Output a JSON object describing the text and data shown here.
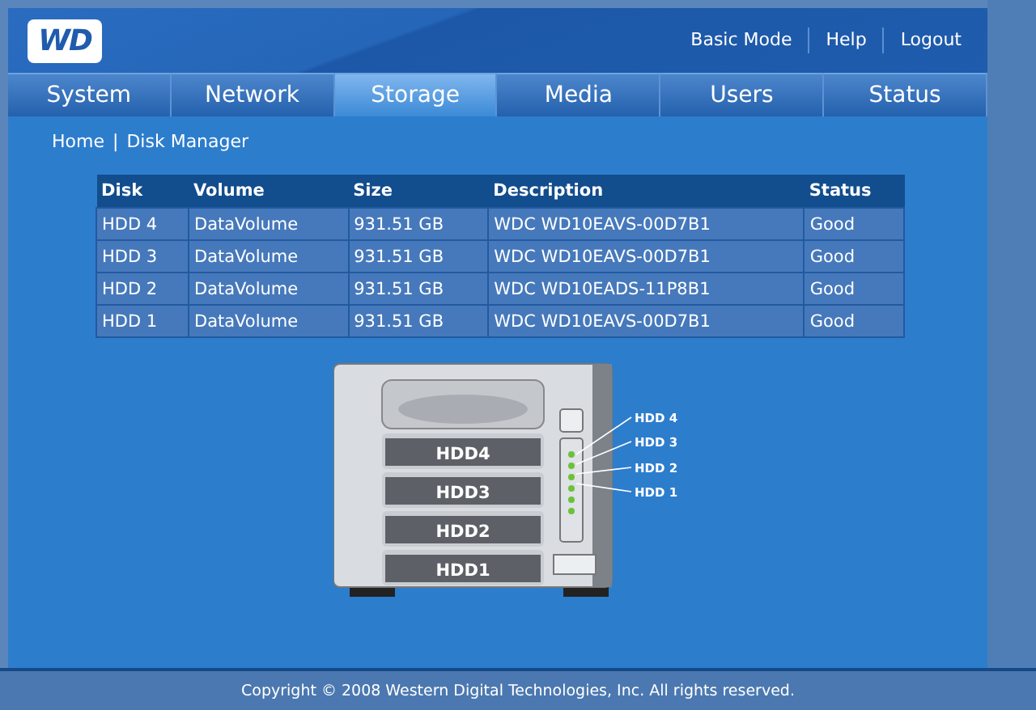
{
  "header": {
    "logo": "WD",
    "links": [
      "Basic Mode",
      "Help",
      "Logout"
    ]
  },
  "tabs": [
    {
      "label": "System",
      "selected": false
    },
    {
      "label": "Network",
      "selected": false
    },
    {
      "label": "Storage",
      "selected": true
    },
    {
      "label": "Media",
      "selected": false
    },
    {
      "label": "Users",
      "selected": false
    },
    {
      "label": "Status",
      "selected": false
    }
  ],
  "breadcrumb": {
    "items": [
      "Home",
      "Disk Manager"
    ],
    "separator": "|"
  },
  "table": {
    "columns": [
      "Disk",
      "Volume",
      "Size",
      "Description",
      "Status"
    ],
    "rows": [
      [
        "HDD 4",
        "DataVolume",
        "931.51 GB",
        "WDC WD10EAVS-00D7B1",
        "Good"
      ],
      [
        "HDD 3",
        "DataVolume",
        "931.51 GB",
        "WDC WD10EAVS-00D7B1",
        "Good"
      ],
      [
        "HDD 2",
        "DataVolume",
        "931.51 GB",
        "WDC WD10EADS-11P8B1",
        "Good"
      ],
      [
        "HDD 1",
        "DataVolume",
        "931.51 GB",
        "WDC WD10EAVS-00D7B1",
        "Good"
      ]
    ]
  },
  "device": {
    "bays": [
      "HDD4",
      "HDD3",
      "HDD2",
      "HDD1"
    ],
    "led_labels": [
      "HDD 4",
      "HDD 3",
      "HDD 2",
      "HDD 1"
    ]
  },
  "footer": "Copyright © 2008 Western Digital Technologies, Inc. All rights reserved."
}
